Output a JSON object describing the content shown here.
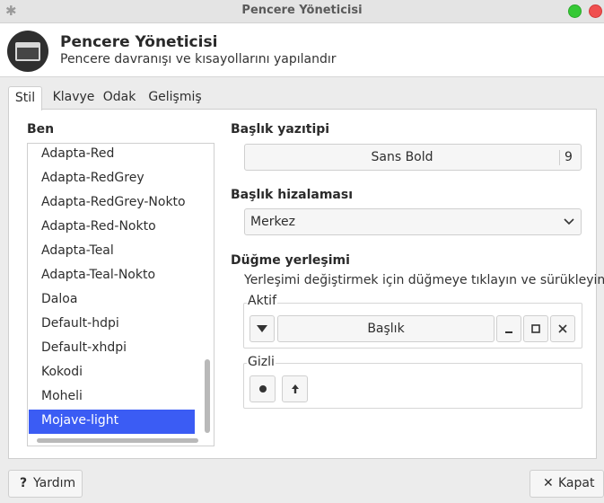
{
  "window": {
    "title": "Pencere Yöneticisi"
  },
  "header": {
    "title": "Pencere Yöneticisi",
    "subtitle": "Pencere davranışı ve kısayollarını yapılandır"
  },
  "tabs": [
    {
      "label": "Stil",
      "active": true
    },
    {
      "label": "Klavye",
      "active": false
    },
    {
      "label": "Odak",
      "active": false
    },
    {
      "label": "Gelişmiş",
      "active": false
    }
  ],
  "theme": {
    "label": "Ben",
    "items": [
      "Adapta-Red",
      "Adapta-RedGrey",
      "Adapta-RedGrey-Nokto",
      "Adapta-Red-Nokto",
      "Adapta-Teal",
      "Adapta-Teal-Nokto",
      "Daloa",
      "Default-hdpi",
      "Default-xhdpi",
      "Kokodi",
      "Moheli",
      "Mojave-light"
    ],
    "selected": "Mojave-light"
  },
  "title_font": {
    "label": "Başlık yazıtipi",
    "font": "Sans Bold",
    "size": "9"
  },
  "title_alignment": {
    "label": "Başlık hizalaması",
    "value": "Merkez"
  },
  "button_layout": {
    "label": "Düğme yerleşimi",
    "hint": "Yerleşimi değiştirmek için düğmeye tıklayın ve sürükleyin",
    "active_label": "Aktif",
    "title_button": "Başlık",
    "hidden_label": "Gizli"
  },
  "footer": {
    "help": "Yardım",
    "close": "Kapat"
  },
  "colors": {
    "selection": "#3b5cf4",
    "maximize": "#35c935",
    "close": "#f04f4f"
  }
}
